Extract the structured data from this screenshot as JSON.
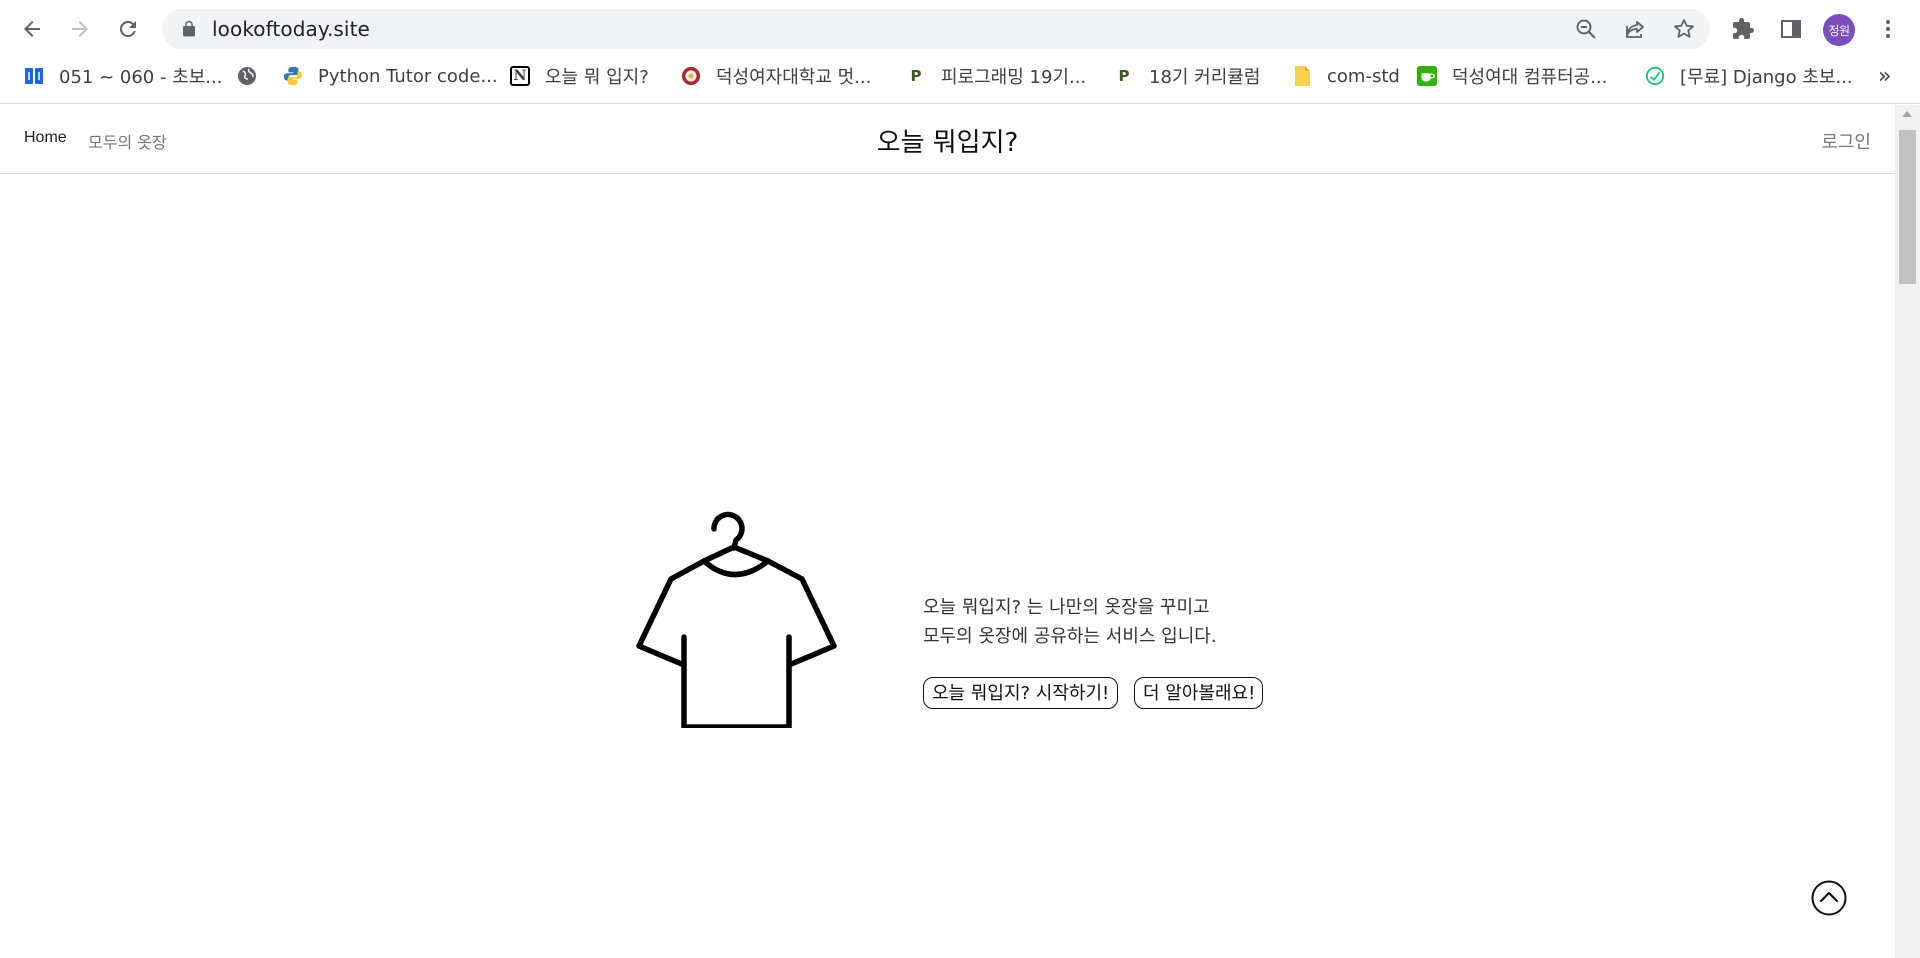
{
  "browser": {
    "url": "lookoftoday.site",
    "profile_label": "정원",
    "bookmarks": [
      {
        "label": "051 ~ 060 - 초보...",
        "icon": "velog-icon",
        "color": "#1e63e9"
      },
      {
        "label": "",
        "icon": "globe-icon",
        "color": "#5f6368"
      },
      {
        "label": "Python Tutor code...",
        "icon": "python-icon",
        "color": "#3776ab"
      },
      {
        "label": "오늘 뭐 입지?",
        "icon": "notion-icon",
        "color": "#000000"
      },
      {
        "label": "덕성여자대학교 멋...",
        "icon": "likelion-icon",
        "color": "#b3262c"
      },
      {
        "label": "피로그래밍 19기...",
        "icon": "pirogramming-icon",
        "color": "#6a8d1f"
      },
      {
        "label": "18기 커리큘럼",
        "icon": "pirogramming-icon",
        "color": "#6a8d1f"
      },
      {
        "label": "com-std",
        "icon": "folder-icon",
        "color": "#f6d250"
      },
      {
        "label": "덕성여대 컴퓨터공...",
        "icon": "cafe-icon",
        "color": "#2db400"
      },
      {
        "label": "[무료] Django 초보...",
        "icon": "inflearn-icon",
        "color": "#1dc078"
      }
    ],
    "more_label": "»"
  },
  "site": {
    "nav": {
      "home": "Home",
      "wardrobe": "모두의 옷장"
    },
    "title": "오늘 뭐입지?",
    "login": "로그인"
  },
  "hero": {
    "description_line1": "오늘 뭐입지? 는 나만의 옷장을 꾸미고",
    "description_line2": "모두의 옷장에 공유하는 서비스 입니다.",
    "start_button": "오늘 뭐입지? 시작하기!",
    "learn_more_button": "더 알아볼래요!",
    "image_icon": "tshirt-hanger-icon"
  }
}
